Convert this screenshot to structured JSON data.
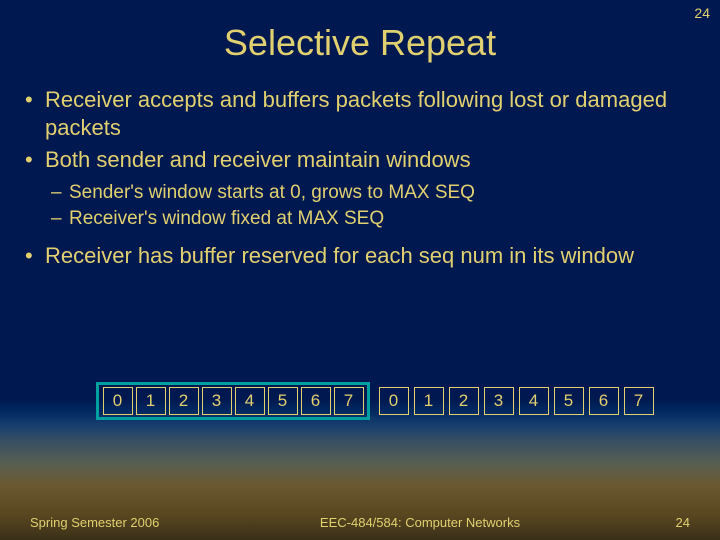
{
  "page_number_top": "24",
  "title": "Selective Repeat",
  "bullets": {
    "b1": "Receiver accepts and buffers packets following lost or damaged packets",
    "b2": "Both sender and receiver maintain windows",
    "b2_sub1": "Sender's window starts at 0, grows to MAX SEQ",
    "b2_sub2": "Receiver's window fixed at MAX SEQ",
    "b3": "Receiver has buffer reserved for each seq num in its window"
  },
  "sequence": {
    "window": [
      "0",
      "1",
      "2",
      "3",
      "4",
      "5",
      "6",
      "7"
    ],
    "rest": [
      "0",
      "1",
      "2",
      "3",
      "4",
      "5",
      "6",
      "7"
    ]
  },
  "footer": {
    "left": "Spring Semester 2006",
    "mid": "EEC-484/584: Computer Networks",
    "right": "24"
  }
}
